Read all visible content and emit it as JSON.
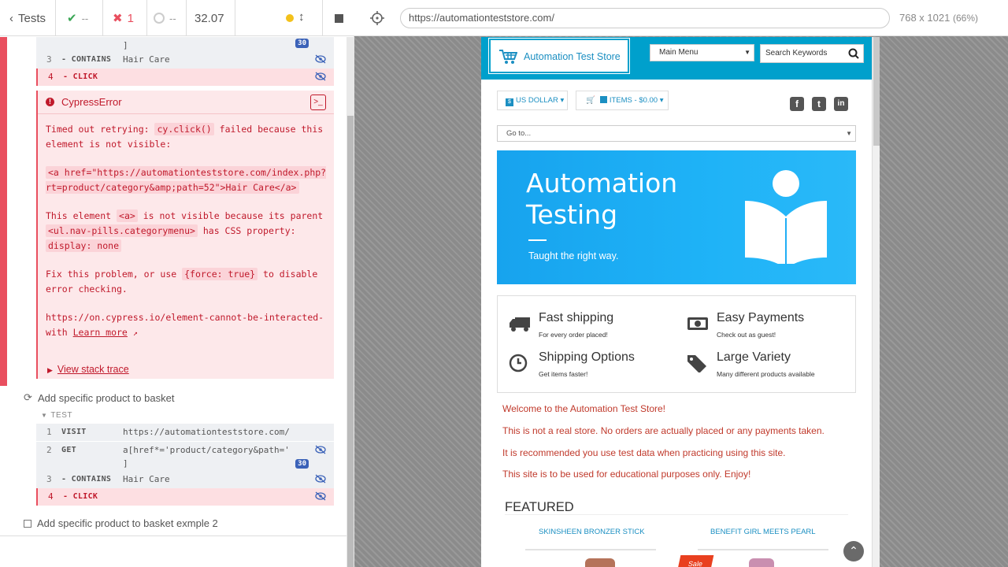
{
  "reporter": {
    "tests_label": "Tests",
    "passed": "--",
    "failed": "1",
    "pending": "--",
    "duration": "32.07",
    "commands_top": [
      {
        "num": "",
        "name": "",
        "msg": "]",
        "badge": "30"
      },
      {
        "num": "3",
        "name": "- CONTAINS",
        "msg": "Hair Care"
      },
      {
        "num": "4",
        "name": "- CLICK",
        "msg": ""
      }
    ],
    "error": {
      "title": "CypressError",
      "p1_a": "Timed out retrying: ",
      "p1_code": "cy.click()",
      "p1_b": " failed because this element is not visible:",
      "p2_code": "<a href=\"https://automationteststore.com/index.php?rt=product/category&amp;path=52\">Hair Care</a>",
      "p3_a": "This element ",
      "p3_code1": "<a>",
      "p3_b": " is not visible because its parent ",
      "p3_code2": "<ul.nav-pills.categorymenu>",
      "p3_c": " has CSS property: ",
      "p3_code3": "display: none",
      "p4_a": "Fix this problem, or use ",
      "p4_code": "{force: true}",
      "p4_b": " to disable error checking.",
      "p5_a": "https://on.cypress.io/element-cannot-be-interacted-with ",
      "p5_link": "Learn more",
      "stack": "View stack trace"
    },
    "test2": {
      "title": "Add specific product to basket",
      "label": "TEST",
      "commands": [
        {
          "num": "1",
          "name": "VISIT",
          "msg": "https://automationteststore.com/"
        },
        {
          "num": "2",
          "name": "GET",
          "msg": "a[href*='product/category&path='",
          "msg2": "]",
          "badge": "30"
        },
        {
          "num": "3",
          "name": "- CONTAINS",
          "msg": "Hair Care"
        },
        {
          "num": "4",
          "name": "- CLICK",
          "msg": ""
        }
      ]
    },
    "test3": {
      "title": "Add specific product to basket exmple 2"
    }
  },
  "aut": {
    "url": "https://automationteststore.com/",
    "viewport": "768 x 1021",
    "zoom": "(66%)"
  },
  "site": {
    "logo_text": "Automation Test Store",
    "main_menu": "Main Menu",
    "search_placeholder": "Search Keywords",
    "currency": "US DOLLAR",
    "cart": "ITEMS - $0.00",
    "goto": "Go to...",
    "banner_line1": "Automation",
    "banner_line2": "Testing",
    "banner_sub": "Taught the right way.",
    "features": [
      {
        "title": "Fast shipping",
        "desc": "For every order placed!"
      },
      {
        "title": "Easy Payments",
        "desc": "Check out as guest!"
      },
      {
        "title": "Shipping Options",
        "desc": "Get items faster!"
      },
      {
        "title": "Large Variety",
        "desc": "Many different products available"
      }
    ],
    "welcome": [
      "Welcome to the Automation Test Store!",
      "This is not a real store. No orders are actually placed or any payments taken.",
      "It is recommended you use test data when practicing using this site.",
      "This site is to be used for educational purposes only. Enjoy!"
    ],
    "featured": "FEATURED",
    "products": [
      "SKINSHEEN BRONZER STICK",
      "BENEFIT GIRL MEETS PEARL"
    ],
    "sale": "Sale",
    "social": [
      "f",
      "t",
      "in"
    ]
  }
}
